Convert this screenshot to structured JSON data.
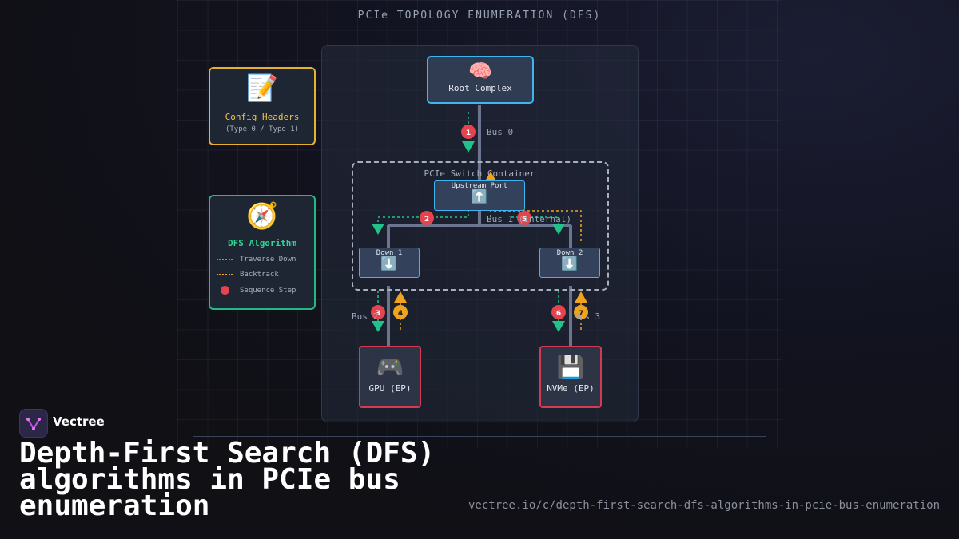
{
  "diagram": {
    "title": "PCIe TOPOLOGY ENUMERATION (DFS)",
    "root_complex": {
      "icon": "brain-icon",
      "emoji": "🧠",
      "label": "Root Complex"
    },
    "config_headers": {
      "icon": "memo-icon",
      "emoji": "📝",
      "title": "Config Headers",
      "subtitle": "(Type 0 / Type 1)"
    },
    "dfs_legend": {
      "icon": "compass-icon",
      "emoji": "🧭",
      "title": "DFS Algorithm",
      "items": [
        {
          "label": "Traverse Down",
          "color": "#22c38a"
        },
        {
          "label": "Backtrack",
          "color": "#f0a41d"
        },
        {
          "label": "Sequence Step",
          "color": "#e5434d"
        }
      ]
    },
    "switch": {
      "label": "PCIe Switch Container",
      "upstream": {
        "label": "Upstream Port",
        "icon": "up-arrow-icon",
        "emoji": "⬆️"
      },
      "down1": {
        "label": "Down 1",
        "icon": "down-arrow-icon",
        "emoji": "⬇️"
      },
      "down2": {
        "label": "Down 2",
        "icon": "down-arrow-icon",
        "emoji": "⬇️"
      }
    },
    "bus_labels": {
      "bus0": "Bus 0",
      "bus1": "Bus 1 (Internal)",
      "bus2": "Bus 2",
      "bus3": "Bus 3"
    },
    "endpoints": {
      "gpu": {
        "label": "GPU (EP)",
        "icon": "game-controller-icon",
        "emoji": "🎮"
      },
      "nvme": {
        "label": "NVMe (EP)",
        "icon": "floppy-disk-icon",
        "emoji": "💾"
      }
    },
    "steps": [
      "1",
      "2",
      "3",
      "4",
      "5",
      "6",
      "7"
    ],
    "colors": {
      "traverse": "#22c38a",
      "backtrack": "#f0a41d",
      "step": "#e5434d",
      "link": "#6b7590",
      "port_border": "#3fb4ee",
      "ep_border": "#d33b55"
    }
  },
  "brand": {
    "name": "Vectree"
  },
  "headline": "Depth-First Search (DFS) algorithms in PCIe bus enumeration",
  "url": "vectree.io/c/depth-first-search-dfs-algorithms-in-pcie-bus-enumeration"
}
